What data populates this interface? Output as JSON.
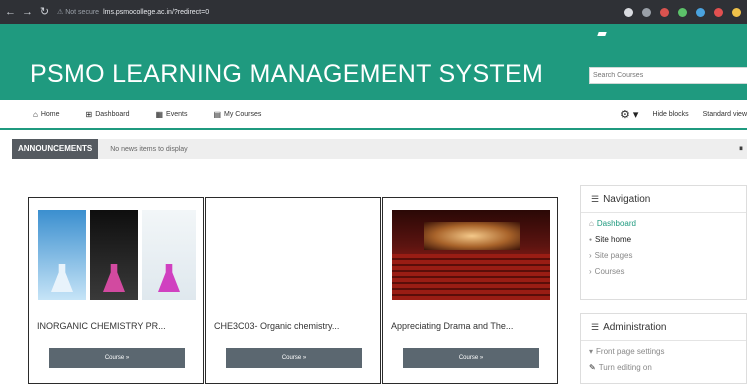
{
  "browser": {
    "back": "←",
    "forward": "→",
    "reload": "↻",
    "security": "⚠ Not secure",
    "url": "lms.psmocollege.ac.in/?redirect=0"
  },
  "header": {
    "title": "PSMO LEARNING MANAGEMENT SYSTEM",
    "search_placeholder": "Search Courses"
  },
  "navbar": {
    "items": [
      {
        "icon": "⌂",
        "label": "Home"
      },
      {
        "icon": "⊞",
        "label": "Dashboard"
      },
      {
        "icon": "▦",
        "label": "Events"
      },
      {
        "icon": "▤",
        "label": "My Courses"
      }
    ],
    "gear": "⚙ ▾",
    "hide_blocks": "Hide blocks",
    "standard_view": "Standard view"
  },
  "announcements": {
    "label": "ANNOUNCEMENTS",
    "text": "No news items to display",
    "pause": "⏸"
  },
  "courses": [
    {
      "title": "INORGANIC CHEMISTRY PR...",
      "button": "Course »"
    },
    {
      "title": "CHE3C03- Organic chemistry...",
      "button": "Course »"
    },
    {
      "title": "Appreciating Drama and The...",
      "button": "Course »"
    }
  ],
  "navigation_block": {
    "title": "Navigation",
    "items": [
      {
        "label": "Dashboard",
        "marker": "⌂"
      },
      {
        "label": "Site home",
        "marker": "●"
      },
      {
        "label": "Site pages",
        "marker": "›"
      },
      {
        "label": "Courses",
        "marker": "›"
      }
    ]
  },
  "admin_block": {
    "title": "Administration",
    "items": [
      {
        "label": "Front page settings",
        "marker": "▾"
      },
      {
        "label": "Turn editing on",
        "marker": "✎"
      }
    ]
  },
  "colors": {
    "header_green": "#1f9a7f",
    "course_button": "#5b6770",
    "announcement_label": "#555a60"
  }
}
